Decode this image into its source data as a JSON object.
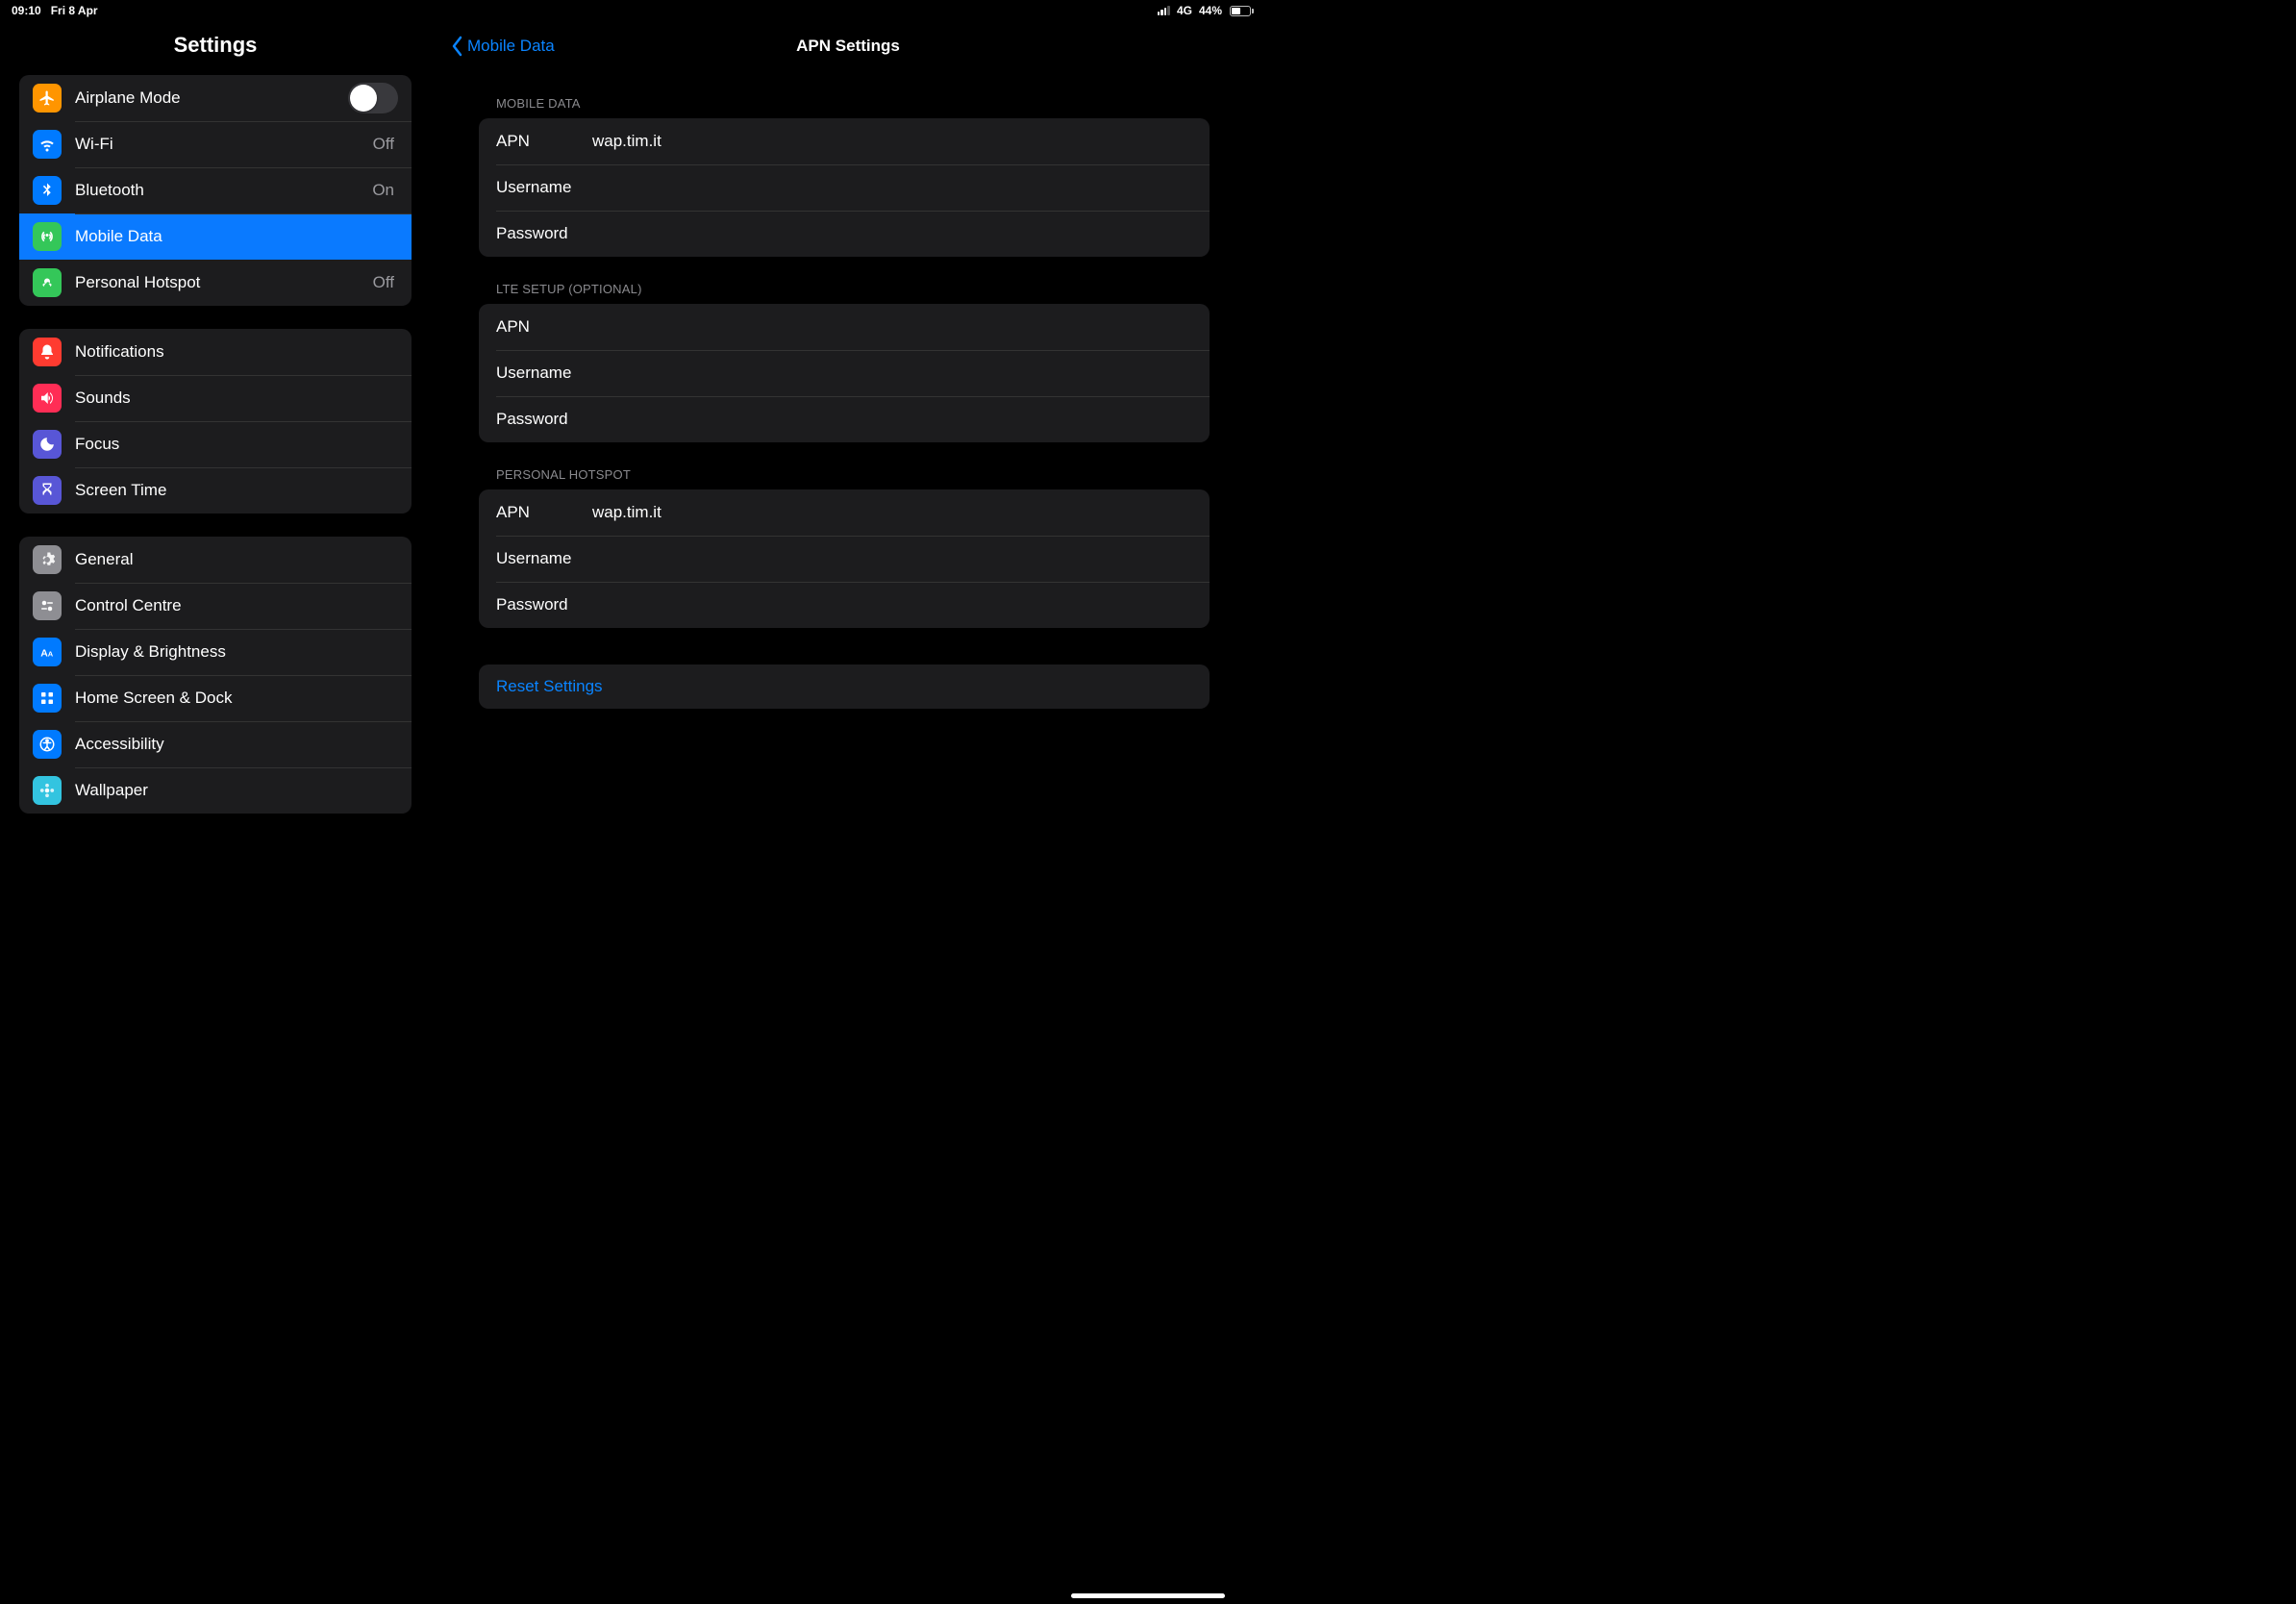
{
  "status": {
    "time": "09:10",
    "date": "Fri 8 Apr",
    "net": "4G",
    "battery_pct": "44%"
  },
  "sidebar": {
    "title": "Settings",
    "g1": [
      {
        "label": "Airplane Mode"
      },
      {
        "label": "Wi-Fi",
        "value": "Off"
      },
      {
        "label": "Bluetooth",
        "value": "On"
      },
      {
        "label": "Mobile Data"
      },
      {
        "label": "Personal Hotspot",
        "value": "Off"
      }
    ],
    "g2": [
      {
        "label": "Notifications"
      },
      {
        "label": "Sounds"
      },
      {
        "label": "Focus"
      },
      {
        "label": "Screen Time"
      }
    ],
    "g3": [
      {
        "label": "General"
      },
      {
        "label": "Control Centre"
      },
      {
        "label": "Display & Brightness"
      },
      {
        "label": "Home Screen & Dock"
      },
      {
        "label": "Accessibility"
      },
      {
        "label": "Wallpaper"
      }
    ]
  },
  "detail": {
    "back": "Mobile Data",
    "title": "APN Settings",
    "sections": [
      {
        "head": "MOBILE DATA",
        "fields": [
          {
            "k": "APN",
            "v": "wap.tim.it"
          },
          {
            "k": "Username",
            "v": ""
          },
          {
            "k": "Password",
            "v": ""
          }
        ]
      },
      {
        "head": "LTE SETUP (OPTIONAL)",
        "fields": [
          {
            "k": "APN",
            "v": ""
          },
          {
            "k": "Username",
            "v": ""
          },
          {
            "k": "Password",
            "v": ""
          }
        ]
      },
      {
        "head": "PERSONAL HOTSPOT",
        "fields": [
          {
            "k": "APN",
            "v": "wap.tim.it"
          },
          {
            "k": "Username",
            "v": ""
          },
          {
            "k": "Password",
            "v": ""
          }
        ]
      }
    ],
    "reset": "Reset Settings"
  }
}
